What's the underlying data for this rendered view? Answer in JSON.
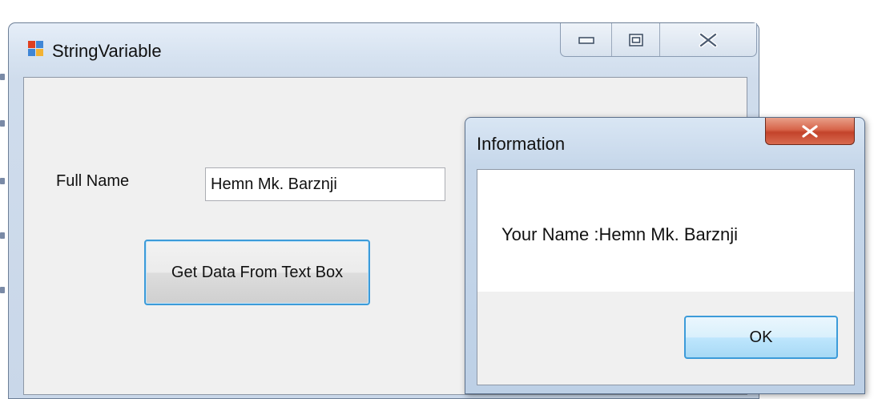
{
  "main_window": {
    "title": "StringVariable",
    "full_name_label": "Full Name",
    "name_value": "Hemn Mk. Barznji",
    "button_label": "Get Data From Text Box"
  },
  "message_box": {
    "title": "Information",
    "message": "Your Name :Hemn Mk. Barznji",
    "ok_label": "OK"
  },
  "colors": {
    "accent_border": "#3c9bd9",
    "close_red": "#c3432b",
    "frame_blue": "#cfdcec"
  },
  "icons": [
    "app-icon",
    "minimize-icon",
    "maximize-icon",
    "close-icon"
  ]
}
